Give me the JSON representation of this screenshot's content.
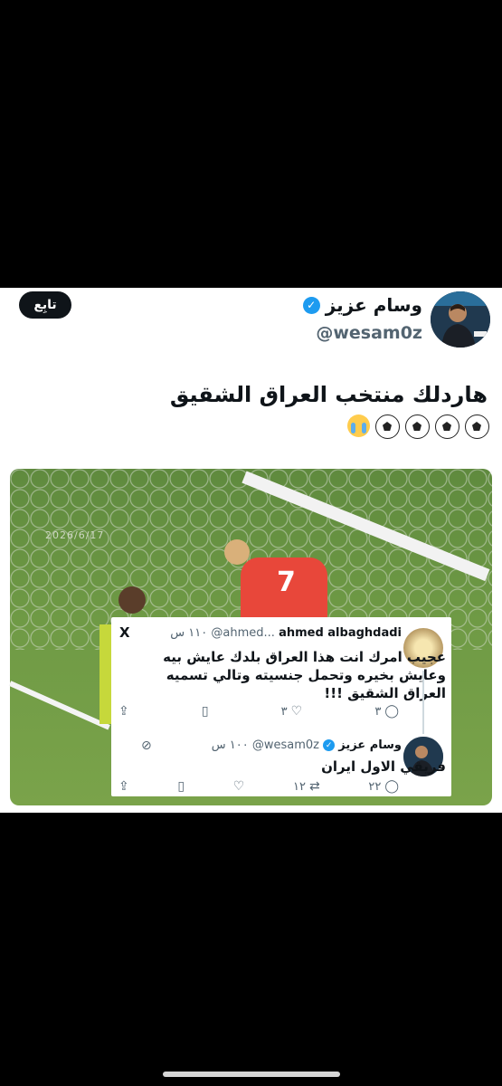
{
  "profile": {
    "display_name": "وسام عزيز",
    "handle": "@wesam0z",
    "follow_label": "تابِع",
    "verified": true
  },
  "tweet": {
    "line1": "هاردلك منتخب العراق الشقيق",
    "emojis": [
      "soccer-ball-icon",
      "soccer-ball-icon",
      "soccer-ball-icon",
      "soccer-ball-icon",
      "loudly-crying-face-icon"
    ]
  },
  "photo": {
    "date_watermark": "2026/6/17",
    "player_number": "7"
  },
  "embedded": {
    "logo": "X",
    "reply1": {
      "name": "ahmed albaghdadi",
      "handle": "@ahmed...",
      "time": "١١٠ س",
      "text": "عجيب امرك انت هذا العراق بلدك عايش بيه وعايش بخيره وتحمل جنسيته وتالي تسميه العراق الشقيق !!!",
      "replies": "٣",
      "retweets": "",
      "likes": "٣"
    },
    "reply2": {
      "name": "وسام عزيز",
      "handle": "@wesam0z",
      "time": "١٠٠ س",
      "text": "فريقي الاول ايران",
      "replies": "٢٢",
      "retweets": "١٢",
      "likes": ""
    }
  }
}
